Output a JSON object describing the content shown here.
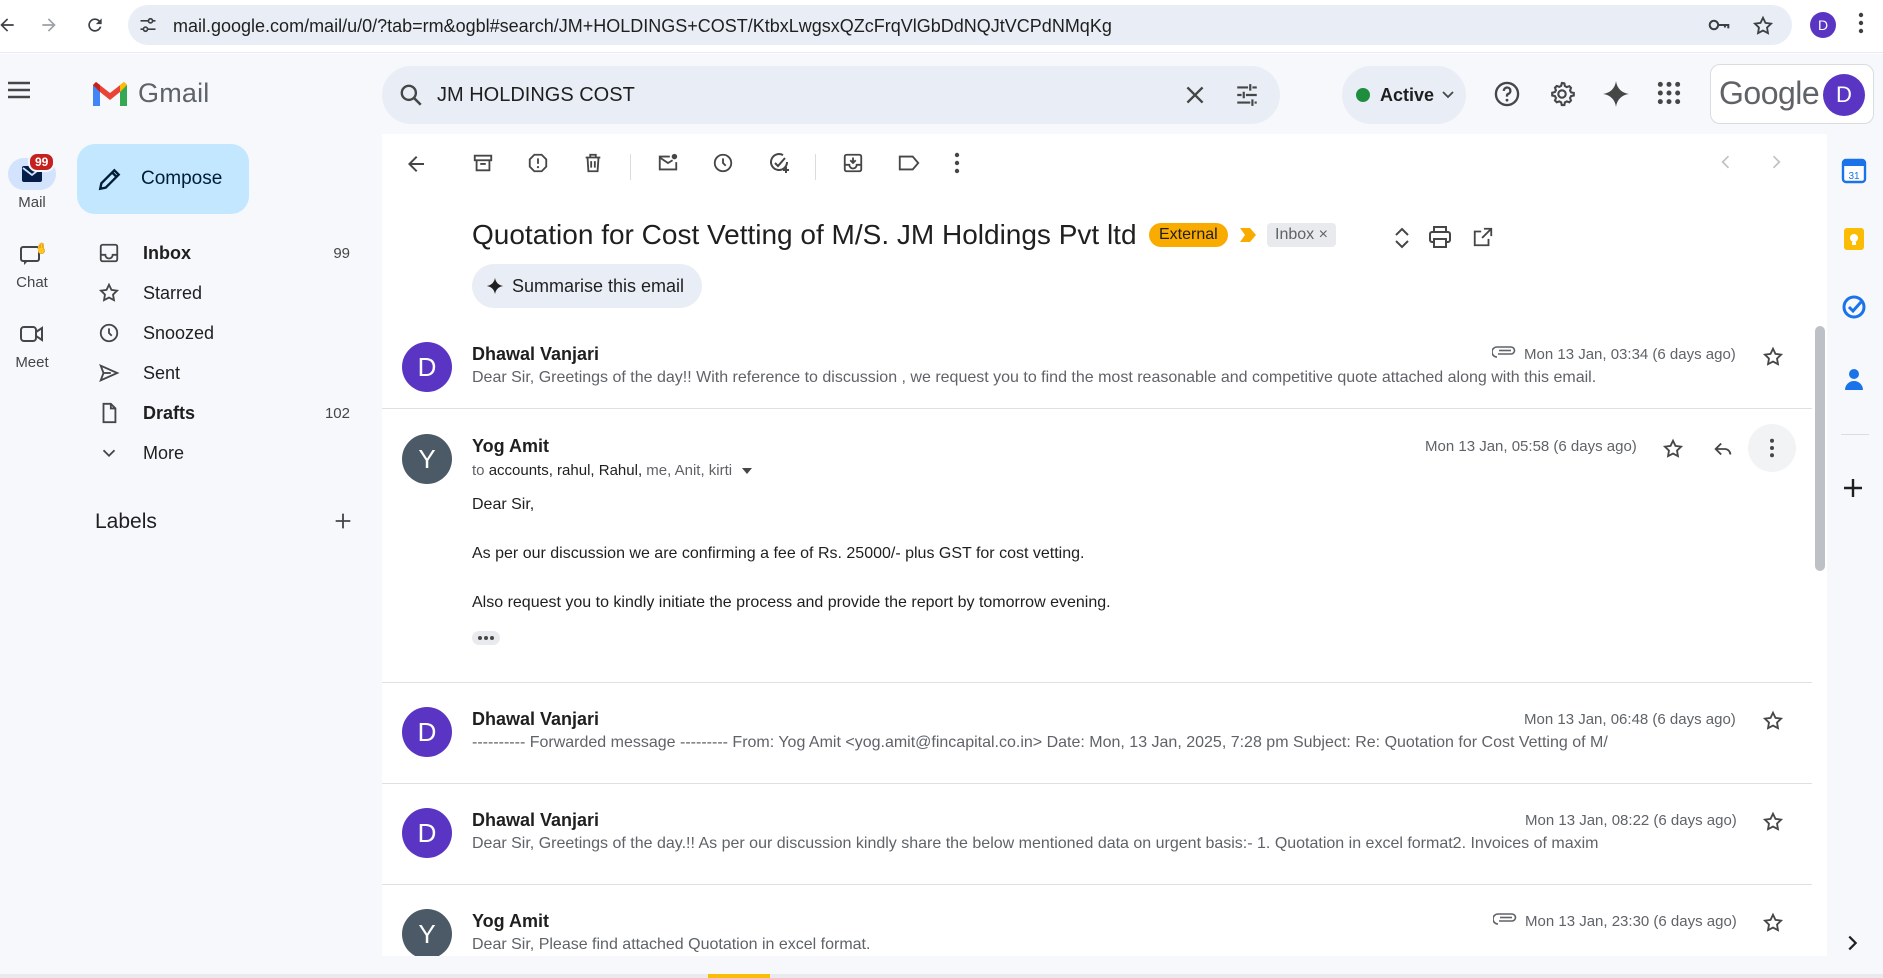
{
  "browser": {
    "url": "mail.google.com/mail/u/0/?tab=rm&ogbl#search/JM+HOLDINGS+COST/KtbxLwgsxQZcFrqVlGbDdNQJtVCPdNMqKg",
    "profile_initial": "D"
  },
  "header": {
    "app_name": "Gmail",
    "search_query": "JM HOLDINGS COST",
    "status": "Active",
    "google_word": "Google",
    "avatar_initial": "D"
  },
  "rail": {
    "mail_label": "Mail",
    "mail_badge": "99",
    "chat_label": "Chat",
    "meet_label": "Meet"
  },
  "sidebar": {
    "compose_label": "Compose",
    "items": [
      {
        "label": "Inbox",
        "count": "99"
      },
      {
        "label": "Starred",
        "count": ""
      },
      {
        "label": "Snoozed",
        "count": ""
      },
      {
        "label": "Sent",
        "count": ""
      },
      {
        "label": "Drafts",
        "count": "102"
      },
      {
        "label": "More",
        "count": ""
      }
    ],
    "labels_header": "Labels"
  },
  "thread": {
    "subject": "Quotation for Cost Vetting of M/S. JM Holdings Pvt ltd",
    "tag_external": "External",
    "tag_inbox": "Inbox",
    "summarise_label": "Summarise this email",
    "messages": [
      {
        "sender": "Dhawal Vanjari",
        "avatar": "D",
        "date": "Mon 13 Jan, 03:34 (6 days ago)",
        "snippet": "Dear Sir, Greetings of the day!! With reference to discussion , we request you to find the most reasonable and competitive quote attached along with this email.",
        "attachment": true
      },
      {
        "sender": "Yog Amit",
        "avatar": "Y",
        "date": "Mon 13 Jan, 05:58 (6 days ago)",
        "to_prefix": "to",
        "to_list": "accounts, rahul, Rahul,",
        "to_rest": "me, Anit, kirti",
        "body": [
          "Dear Sir,",
          "As per our discussion we are confirming a fee of Rs. 25000/- plus GST for cost vetting.",
          "Also request you to kindly initiate the process and provide the report by tomorrow evening."
        ]
      },
      {
        "sender": "Dhawal Vanjari",
        "avatar": "D",
        "date": "Mon 13 Jan, 06:48 (6 days ago)",
        "snippet": "---------- Forwarded message --------- From: Yog Amit <yog.amit@fincapital.co.in> Date: Mon, 13 Jan, 2025, 7:28 pm Subject: Re: Quotation for Cost Vetting of M/"
      },
      {
        "sender": "Dhawal Vanjari",
        "avatar": "D",
        "date": "Mon 13 Jan, 08:22 (6 days ago)",
        "snippet": "Dear Sir, Greetings of the day.!! As per our discussion kindly share the below mentioned data on urgent basis:- 1. Quotation in excel format2. Invoices of maxim"
      },
      {
        "sender": "Yog Amit",
        "avatar": "Y",
        "date": "Mon 13 Jan, 23:30 (6 days ago)",
        "snippet": "Dear Sir, Please find attached Quotation in excel format.",
        "attachment": true
      }
    ]
  },
  "colors": {
    "compose_bg": "#c2e7ff",
    "external_tag": "#f9ab00",
    "avatar_d": "#5a35c4",
    "avatar_y": "#4b5a66",
    "active_dot": "#1e8e3e"
  }
}
